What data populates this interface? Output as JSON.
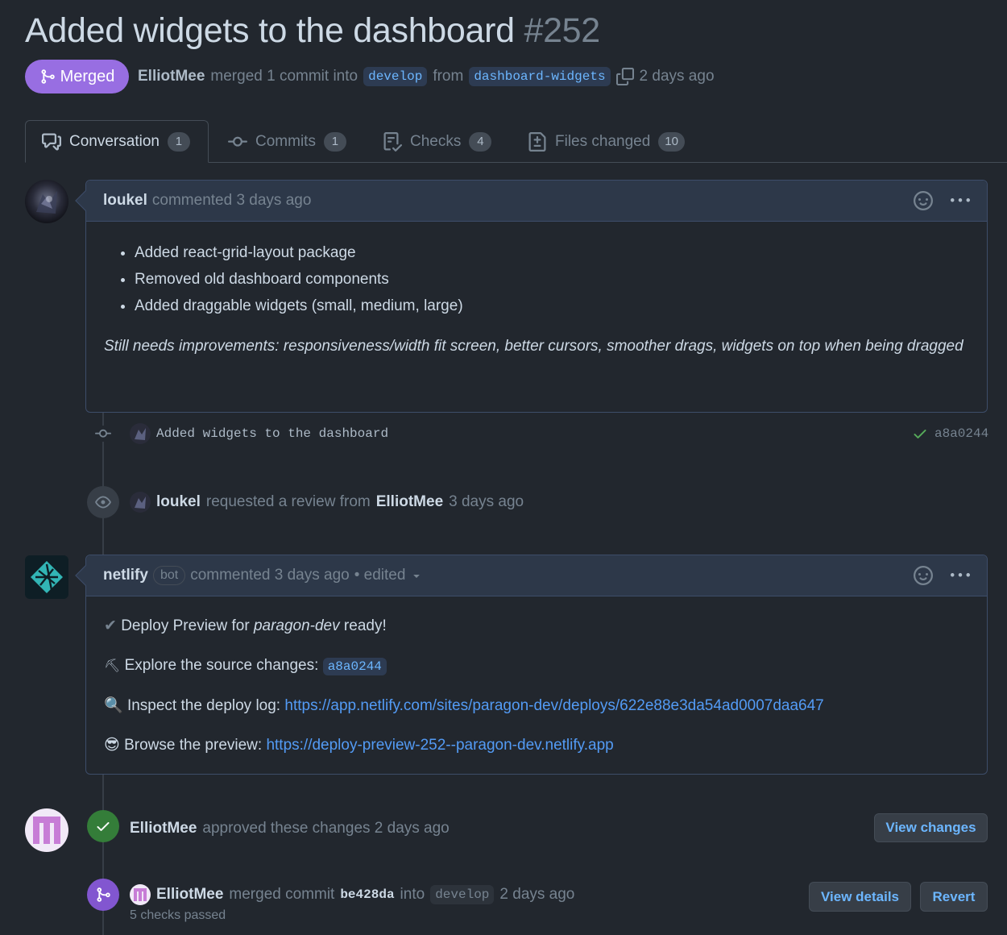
{
  "pr": {
    "title": "Added widgets to the dashboard",
    "number": "#252",
    "status": "Merged",
    "merger": "ElliotMee",
    "merge_text": "merged 1 commit into",
    "base_branch": "develop",
    "from_text": "from",
    "head_branch": "dashboard-widgets",
    "time": "2 days ago"
  },
  "tabs": [
    {
      "label": "Conversation",
      "count": "1",
      "icon": "comment-discussion-icon"
    },
    {
      "label": "Commits",
      "count": "1",
      "icon": "git-commit-icon"
    },
    {
      "label": "Checks",
      "count": "4",
      "icon": "checklist-icon"
    },
    {
      "label": "Files changed",
      "count": "10",
      "icon": "file-diff-icon"
    }
  ],
  "comment1": {
    "author": "loukel",
    "meta": "commented 3 days ago",
    "items": [
      "Added react-grid-layout package",
      "Removed old dashboard components",
      "Added draggable widgets (small, medium, large)"
    ],
    "note": "Still needs improvements: responsiveness/width fit screen, better cursors, smoother drags, widgets on top when being dragged"
  },
  "commit_event": {
    "message": "Added widgets to the dashboard",
    "sha": "a8a0244"
  },
  "review_request": {
    "actor": "loukel",
    "text": "requested a review from",
    "reviewer": "ElliotMee",
    "time": "3 days ago"
  },
  "comment2": {
    "author": "netlify",
    "bot_label": "bot",
    "meta": "commented 3 days ago",
    "edited": "• edited",
    "line1_prefix": "Deploy Preview for",
    "line1_site": "paragon-dev",
    "line1_suffix": "ready!",
    "line2_prefix": "Explore the source changes:",
    "line2_sha": "a8a0244",
    "line3_prefix": "Inspect the deploy log:",
    "line3_link": "https://app.netlify.com/sites/paragon-dev/deploys/622e88e3da54ad0007daa647",
    "line4_prefix": "Browse the preview:",
    "line4_link": "https://deploy-preview-252--paragon-dev.netlify.app"
  },
  "approval": {
    "actor": "ElliotMee",
    "text": "approved these changes 2 days ago",
    "button": "View changes"
  },
  "merge_event": {
    "actor": "ElliotMee",
    "text1": "merged commit",
    "sha": "be428da",
    "text2": "into",
    "branch": "develop",
    "time": "2 days ago",
    "checks": "5 checks passed",
    "details_button": "View details",
    "revert_button": "Revert"
  },
  "colors": {
    "background": "#22272e",
    "merged": "#986ee2",
    "approved": "#347d39",
    "link": "#539bf5"
  }
}
